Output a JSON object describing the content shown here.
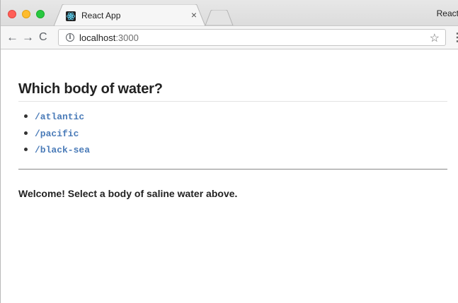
{
  "browser": {
    "tab": {
      "title": "React App",
      "close_glyph": "×"
    },
    "profile_text": "React",
    "nav": {
      "back_glyph": "←",
      "forward_glyph": "→",
      "reload_glyph": "C"
    },
    "address": {
      "host": "localhost",
      "port": ":3000"
    },
    "info_glyph": "i",
    "star_glyph": "☆",
    "menu_glyph": "⋮"
  },
  "page": {
    "heading": "Which body of water?",
    "links": [
      "/atlantic",
      "/pacific",
      "/black-sea"
    ],
    "message": "Welcome! Select a body of saline water above."
  },
  "colors": {
    "link": "#4a7bb8",
    "close": "#ff5f57",
    "minimize": "#febc2e",
    "maximize": "#28c840"
  },
  "icons": [
    "back-arrow-icon",
    "forward-arrow-icon",
    "reload-icon",
    "info-icon",
    "star-icon",
    "menu-icon",
    "react-logo-icon",
    "close-icon"
  ]
}
